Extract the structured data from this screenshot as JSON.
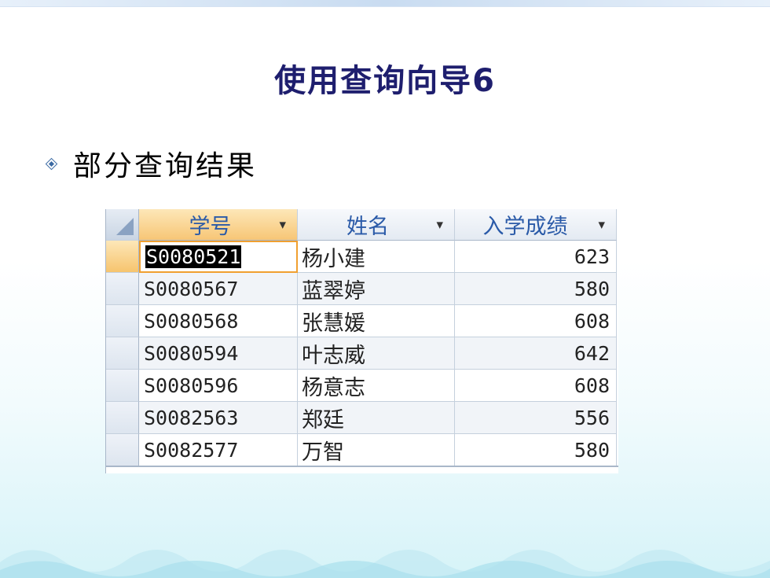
{
  "slide": {
    "title": "使用查询向导6",
    "bullet": "部分查询结果"
  },
  "table": {
    "columns": [
      {
        "label": "学号"
      },
      {
        "label": "姓名"
      },
      {
        "label": "入学成绩"
      }
    ],
    "rows": [
      {
        "id": "S0080521",
        "name": "杨小建",
        "score": "623"
      },
      {
        "id": "S0080567",
        "name": "蓝翠婷",
        "score": "580"
      },
      {
        "id": "S0080568",
        "name": "张慧媛",
        "score": "608"
      },
      {
        "id": "S0080594",
        "name": "叶志威",
        "score": "642"
      },
      {
        "id": "S0080596",
        "name": "杨意志",
        "score": "608"
      },
      {
        "id": "S0082563",
        "name": "郑廷",
        "score": "556"
      },
      {
        "id": "S0082577",
        "name": "万智",
        "score": "580"
      }
    ]
  },
  "colors": {
    "title": "#1e1e6e",
    "header_text": "#2a5aa8",
    "active_header": "#f7c676"
  },
  "icons": {
    "dropdown": "chevron-down-icon",
    "bullet": "diamond-bullet-icon",
    "select_all": "select-all-corner-icon"
  }
}
